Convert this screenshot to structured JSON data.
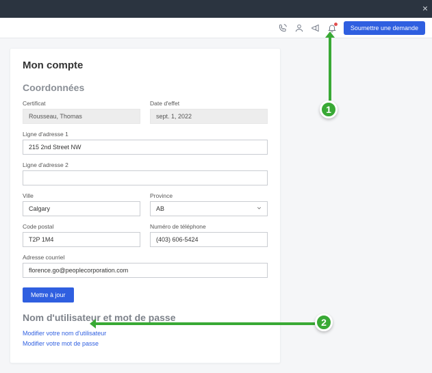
{
  "header": {
    "submit_label": "Soumettre une demande"
  },
  "page": {
    "title": "Mon compte",
    "section1_title": "Coordonnées",
    "certificate_label": "Certificat",
    "certificate_value": "Rousseau, Thomas",
    "effective_label": "Date d'effet",
    "effective_value": "sept. 1, 2022",
    "addr1_label": "Ligne d'adresse 1",
    "addr1_value": "215 2nd Street NW",
    "addr2_label": "Ligne d'adresse 2",
    "addr2_value": "",
    "city_label": "Ville",
    "city_value": "Calgary",
    "province_label": "Province",
    "province_value": "AB",
    "postal_label": "Code postal",
    "postal_value": "T2P 1M4",
    "phone_label": "Numéro de téléphone",
    "phone_value": "(403) 606-5424",
    "email_label": "Adresse courriel",
    "email_value": "florence.go@peoplecorporation.com",
    "update_label": "Mettre à jour",
    "section2_title": "Nom d'utilisateur et mot de passe",
    "link_username": "Modifier votre nom d'utilisateur",
    "link_password": "Modifier votre mot de passe"
  },
  "callouts": {
    "c1": "1",
    "c2": "2"
  }
}
